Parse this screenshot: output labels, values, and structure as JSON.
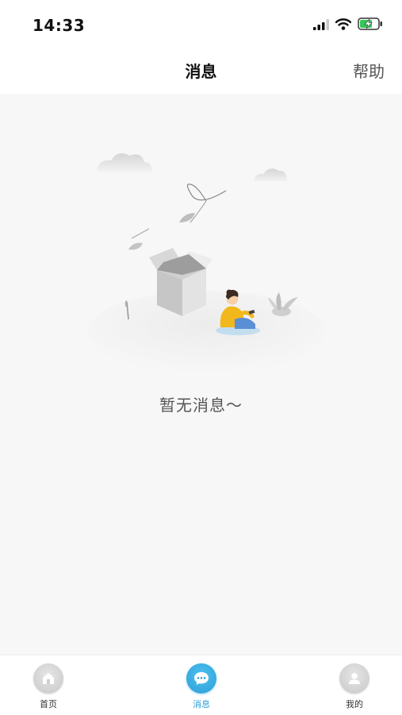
{
  "status_bar": {
    "time": "14:33"
  },
  "nav": {
    "title": "消息",
    "help_label": "帮助"
  },
  "empty_state": {
    "message": "暂无消息～",
    "illustration": "empty-box-illustration-icon"
  },
  "tab_bar": {
    "tabs": [
      {
        "label": "首页",
        "icon": "home-icon",
        "active": false
      },
      {
        "label": "消息",
        "icon": "chat-bubble-icon",
        "active": true
      },
      {
        "label": "我的",
        "icon": "person-icon",
        "active": false
      }
    ]
  },
  "colors": {
    "accent": "#2a9fd8",
    "background": "#f7f7f7"
  }
}
